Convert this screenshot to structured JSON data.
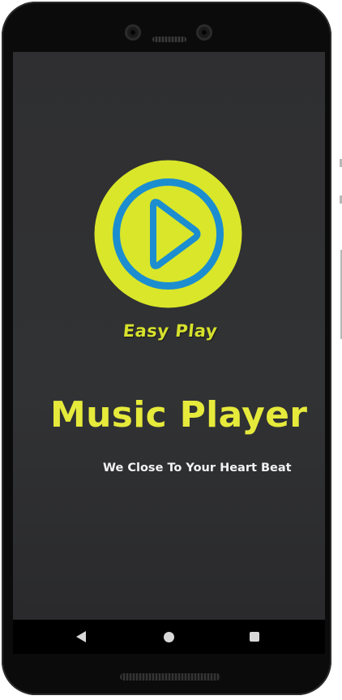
{
  "app": {
    "logo_caption": "Easy Play",
    "title": "Music Player",
    "tagline": "We Close To Your Heart Beat"
  },
  "icons": {
    "logo": "play-logo-icon",
    "nav_back": "back-triangle-icon",
    "nav_home": "home-circle-icon",
    "nav_recents": "recents-square-icon"
  },
  "colors": {
    "screen_background": "#313234",
    "logo_outer_ring": "#d9e62a",
    "logo_blue_ring": "#1c8ed0",
    "title_yellow": "#e6ea3b",
    "tagline_white": "#f2f2f2",
    "navbar": "#000000"
  }
}
